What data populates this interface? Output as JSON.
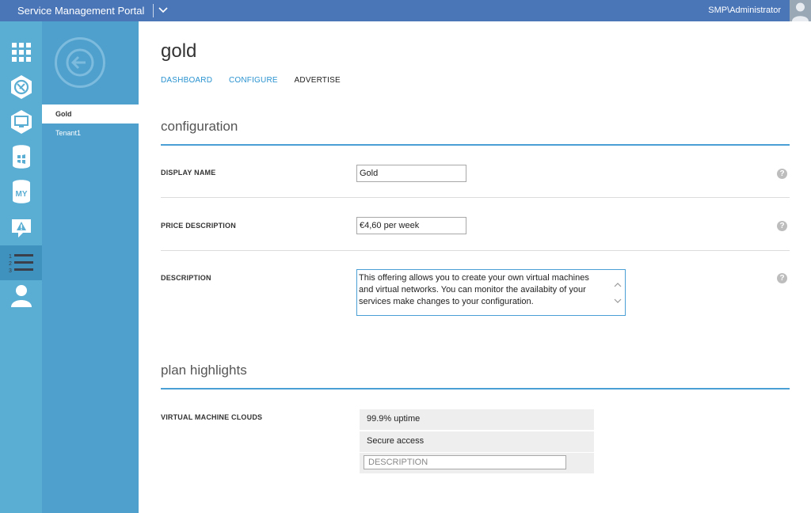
{
  "topbar": {
    "app_title": "Service Management Portal",
    "user": "SMP\\Administrator"
  },
  "navpanel": {
    "items": [
      {
        "label": "Gold",
        "selected": true
      },
      {
        "label": "Tenant1",
        "selected": false
      }
    ]
  },
  "page": {
    "title": "gold",
    "tabs": [
      {
        "label": "DASHBOARD"
      },
      {
        "label": "CONFIGURE"
      },
      {
        "label": "ADVERTISE"
      }
    ]
  },
  "configuration": {
    "heading": "configuration",
    "display_name": {
      "label": "DISPLAY NAME",
      "value": "Gold"
    },
    "price_description": {
      "label": "PRICE DESCRIPTION",
      "value": "€4,60 per week"
    },
    "description": {
      "label": "DESCRIPTION",
      "value": "This offering allows you to create your own virtual machines and virtual networks. You can monitor the availabity of your services make changes to your configuration."
    }
  },
  "plan_highlights": {
    "heading": "plan highlights",
    "label": "VIRTUAL MACHINE CLOUDS",
    "rows": [
      "99.9% uptime",
      "Secure access"
    ],
    "new_placeholder": "DESCRIPTION"
  },
  "icons": [
    "all-items-grid-icon",
    "web-sites-icon",
    "virtual-machines-icon",
    "sql-database-icon",
    "my-sql-icon",
    "alert-icon",
    "plans-list-icon",
    "user-accounts-icon"
  ],
  "colors": {
    "topbar": "#4a76b8",
    "iconbar": "#5aaed3",
    "navpanel": "#4fa0cc",
    "accent": "#2a93d0"
  }
}
